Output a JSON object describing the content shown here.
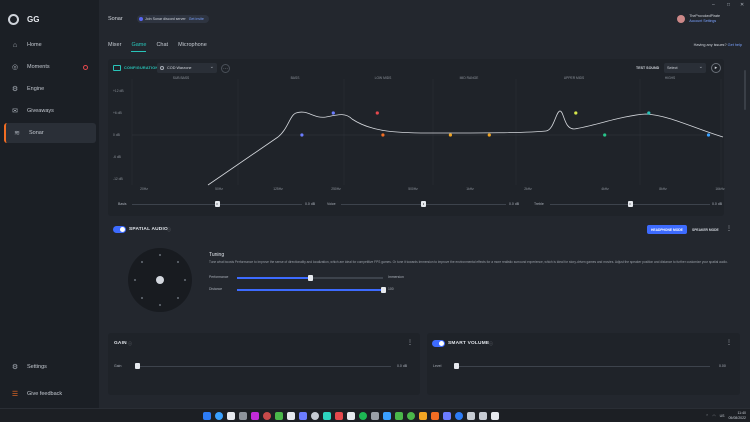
{
  "app": {
    "logo_text": "GG",
    "window_controls": [
      "–",
      "□",
      "✕"
    ]
  },
  "sidebar": {
    "items": [
      {
        "label": "Home",
        "icon": "home-icon",
        "glyph": "⌂"
      },
      {
        "label": "Moments",
        "icon": "moments-icon",
        "glyph": "◎"
      },
      {
        "label": "Engine",
        "icon": "engine-icon",
        "glyph": "⚙"
      },
      {
        "label": "Giveaways",
        "icon": "giveaways-icon",
        "glyph": "✉"
      },
      {
        "label": "Sonar",
        "icon": "sonar-icon",
        "glyph": "≋"
      }
    ],
    "bottom_items": [
      {
        "label": "Settings",
        "icon": "settings-icon",
        "glyph": "⚙"
      },
      {
        "label": "Give feedback",
        "icon": "feedback-icon",
        "glyph": "☰"
      }
    ]
  },
  "header": {
    "title": "Sonar",
    "discord_text": "Join Sonar discord server",
    "discord_link": "Get invite",
    "user_name": "TheProvokedPirate",
    "user_sub": "Account Settings"
  },
  "tabs": [
    "Mixer",
    "Game",
    "Chat",
    "Microphone"
  ],
  "active_tab": "Game",
  "help": {
    "text": "Having any issues?",
    "link": "Get help"
  },
  "eq": {
    "config_label": "CONFIGURATION",
    "config_value": "COD Warzone",
    "test_sound_label": "TEST SOUND",
    "test_sound_value": "Select",
    "band_labels": [
      "SUB BASS",
      "BASS",
      "LOW MIDS",
      "MID RANGE",
      "UPPER MIDS",
      "HIGHS"
    ],
    "y_labels": [
      "+12 dB",
      "+6 dB",
      "0 dB",
      "-6 dB",
      "-12 dB"
    ],
    "x_labels": [
      "20Hz",
      "50Hz",
      "125Hz",
      "250Hz",
      "500Hz",
      "1kHz",
      "2kHz",
      "4kHz",
      "8kHz",
      "16kHz"
    ],
    "curve_color": "#d6d9de",
    "points": [
      {
        "color": "#6b7cff",
        "freq": "125Hz",
        "gain_db": 0
      },
      {
        "color": "#6b7cff",
        "freq": "180Hz",
        "gain_db": 6
      },
      {
        "color": "#e5484d",
        "freq": "300Hz",
        "gain_db": 6
      },
      {
        "color": "#f16d23",
        "freq": "320Hz",
        "gain_db": 0
      },
      {
        "color": "#f1a523",
        "freq": "700Hz",
        "gain_db": 0
      },
      {
        "color": "#f1a523",
        "freq": "1.1kHz",
        "gain_db": 0
      },
      {
        "color": "#d6e64a",
        "freq": "3kHz",
        "gain_db": 6
      },
      {
        "color": "#28c48a",
        "freq": "4.2kHz",
        "gain_db": 0
      },
      {
        "color": "#28c4b9",
        "freq": "7kHz",
        "gain_db": 6
      },
      {
        "color": "#3aa0ff",
        "freq": "14kHz",
        "gain_db": 0
      }
    ],
    "sliders": [
      {
        "name": "Basis",
        "value": "0.0 dB",
        "level": 0.5
      },
      {
        "name": "Voice",
        "value": "0.0 dB",
        "level": 0.5
      },
      {
        "name": "Treble",
        "value": "0.0 dB",
        "level": 0.5
      }
    ]
  },
  "spatial": {
    "title": "SPATIAL AUDIO",
    "enabled": true,
    "headphone_mode": "HEADPHONE MODE",
    "speaker_mode": "SPEAKER MODE",
    "tuning_title": "Tuning",
    "tuning_desc": "Tune what boosts Performance to improve the sense of directionality and localization, which are ideal for competitive FPS games. Or tune it towards Immersion to improve the environmental effects for a more realistic surround experience, which is ideal for story-driven games and movies. Adjust the speaker position and distance to further customize your spatial audio.",
    "performance_label": "Performance",
    "immersion_label": "Immersion",
    "performance_level": 0.5,
    "distance_label": "Distance",
    "distance_value": "100",
    "distance_level": 1.0
  },
  "gain": {
    "title": "GAIN",
    "row_label": "Gain",
    "value": "0.0 dB",
    "level": 0.0
  },
  "smart_volume": {
    "title": "SMART VOLUME",
    "enabled": true,
    "row_label": "Level",
    "value": "0.00",
    "level": 0.0
  },
  "taskbar": {
    "time": "11:40",
    "date": "05/08/2022",
    "lang": "US",
    "icon_colors": [
      "#2d7cf6",
      "#3aa0ff",
      "#e6e9ee",
      "#8e949c",
      "#c22bd8",
      "#c84a4a",
      "#4ab84a",
      "#e6e9ee",
      "#6b7cff",
      "#c6cbd3",
      "#2dd4bf",
      "#e5484d",
      "#e6e9ee",
      "#1db954",
      "#9aa0a8",
      "#3aa0ff",
      "#4ab84a",
      "#4ab84a",
      "#f1a523",
      "#f16d23",
      "#6b7cff",
      "#2d7cf6",
      "#c6cbd3",
      "#c6cbd3",
      "#e6e9ee"
    ]
  }
}
